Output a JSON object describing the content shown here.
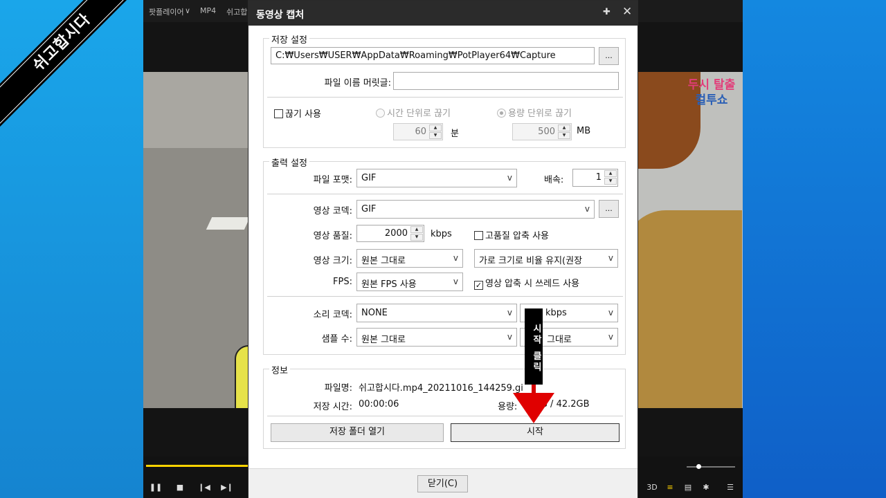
{
  "overlay": {
    "corner_ribbon": "쉬고합시다",
    "annotation_label": "시작 클릭"
  },
  "player": {
    "menu_label": "팟플레이어",
    "menu_arrow": "∨",
    "format_label": "MP4",
    "file_title": "쉬고합"
  },
  "video_logo": {
    "line1": "두시 탈출",
    "line2": "컬투쇼"
  },
  "dialog": {
    "title": "동영상 캡처",
    "pin_icon": "pin-icon",
    "close_icon": "close-icon",
    "save_settings": {
      "title": "저장 설정",
      "path": "C:₩Users₩USER₩AppData₩Roaming₩PotPlayer64₩Capture",
      "browse_label": "...",
      "filename_prefix_label": "파일 이름 머릿글:",
      "filename_prefix_value": "",
      "split_enable_label": "끊기 사용",
      "split_by_time_label": "시간 단위로 끊기",
      "split_by_size_label": "용량 단위로 끊기",
      "time_value": "60",
      "time_unit": "분",
      "size_value": "500",
      "size_unit": "MB"
    },
    "output_settings": {
      "title": "출력 설정",
      "file_format_label": "파일 포맷:",
      "file_format_value": "GIF",
      "speed_label": "배속:",
      "speed_value": "1",
      "video_codec_label": "영상 코덱:",
      "video_codec_value": "GIF",
      "codec_options_label": "...",
      "video_quality_label": "영상 품질:",
      "video_quality_value": "2000",
      "video_quality_unit": "kbps",
      "hq_compress_label": "고품질 압축 사용",
      "video_size_label": "영상 크기:",
      "video_size_value": "원본 그대로",
      "aspect_value": "가로 크기로 비율 유지(권장",
      "fps_label": "FPS:",
      "fps_value": "원본 FPS 사용",
      "thread_label": "영상 압축 시 쓰레드 사용",
      "audio_codec_label": "소리 코덱:",
      "audio_codec_value": "NONE",
      "audio_bitrate_value": "kbps",
      "sample_rate_label": "샘플 수:",
      "sample_rate_value": "원본 그대로",
      "channels_value": "그대로"
    },
    "info": {
      "title": "정보",
      "filename_label": "파일명:",
      "filename_value": "쉬고합시다.mp4_20211016_144259.gi",
      "save_time_label": "저장 시간:",
      "save_time_value": "00:00:06",
      "size_label": "용량:",
      "size_value": "B / 42.2GB"
    },
    "open_folder_label": "저장 폴더 열기",
    "start_label": "시작",
    "close_label": "닫기(C)"
  },
  "colors": {
    "arrow": "#e00000",
    "accent": "#ffd400"
  }
}
